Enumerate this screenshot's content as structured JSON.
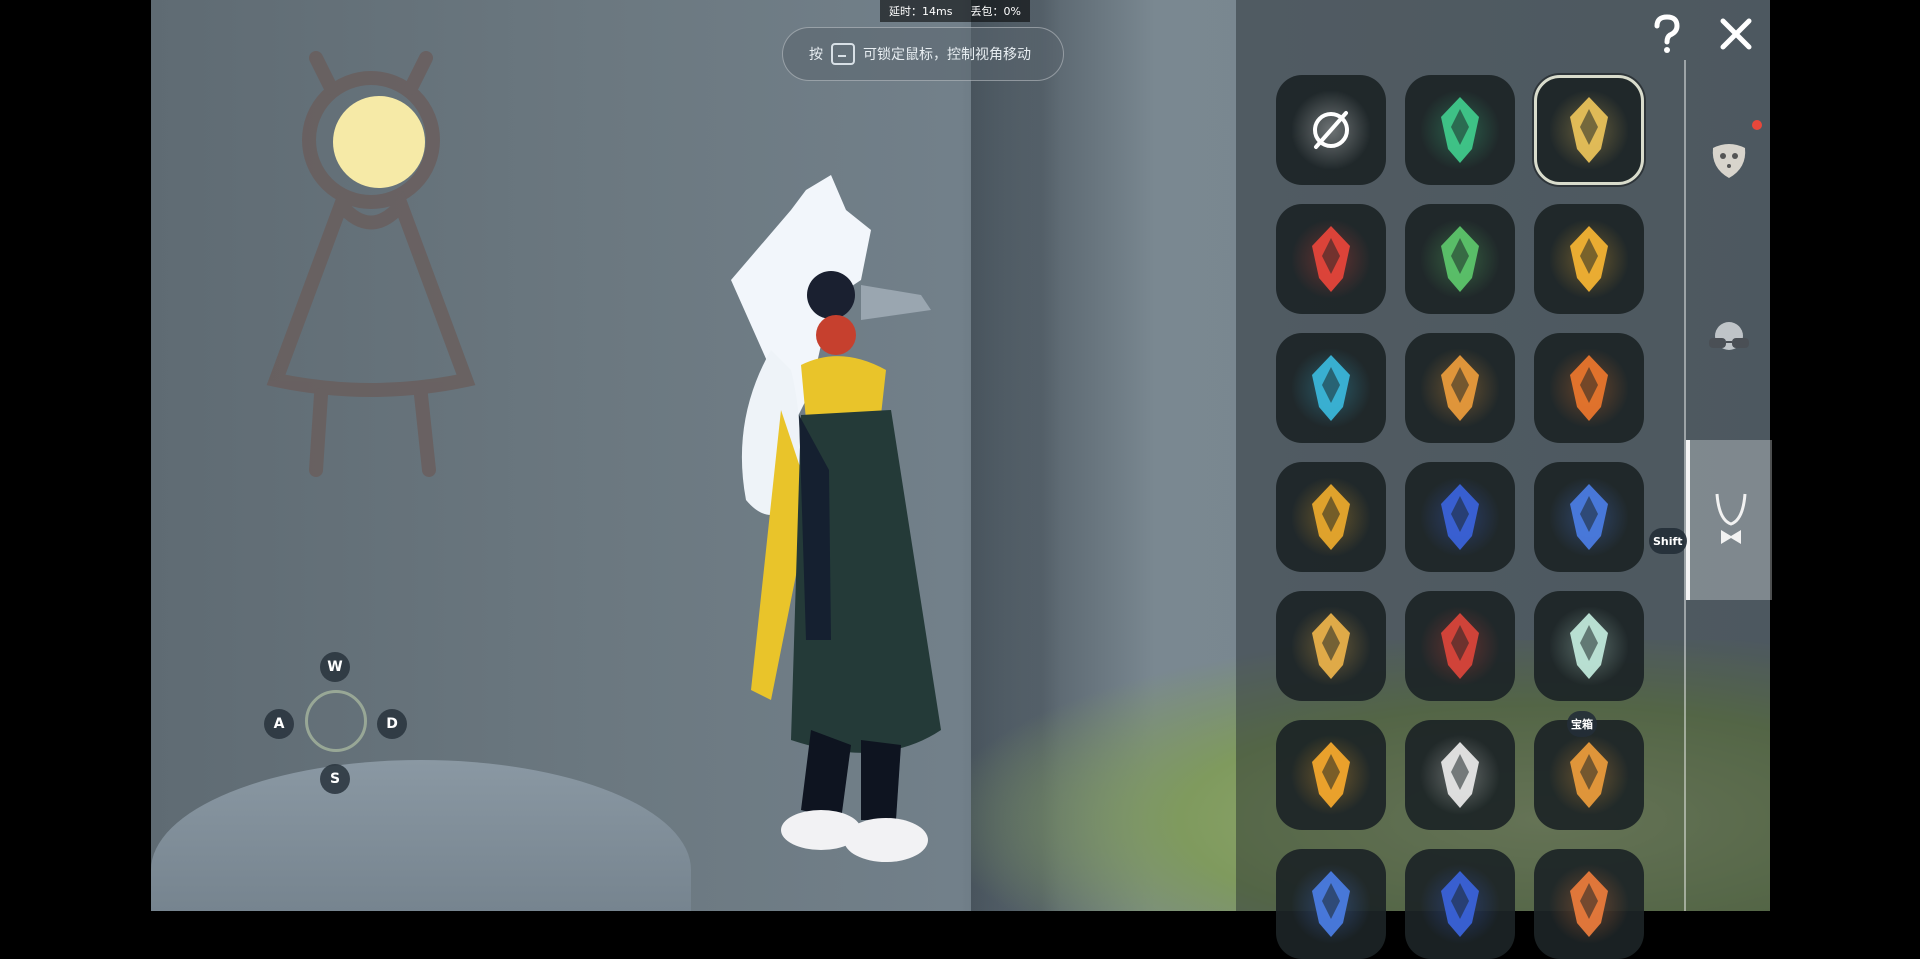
{
  "hud": {
    "latency": "延时：14ms",
    "packet_loss": "丢包：0%"
  },
  "hint": {
    "prefix": "按",
    "text": "可锁定鼠标，控制视角移动"
  },
  "joystick": {
    "up": "W",
    "left": "A",
    "right": "D",
    "down": "S"
  },
  "top_bar": {
    "help_icon": "question-mark-icon",
    "close_icon": "close-x-icon"
  },
  "panel": {
    "shift_hint": "Shift",
    "treasure_label": "宝箱",
    "items": [
      {
        "icon": "none-slash-icon",
        "color": "#ffffff"
      },
      {
        "icon": "trident-emblem-icon",
        "color": "#3fc88a"
      },
      {
        "icon": "star-compass-emblem-icon",
        "color": "#e8c15a",
        "selected": true
      },
      {
        "icon": "castle-emblem-icon",
        "color": "#e4443a"
      },
      {
        "icon": "fleur-de-lis-emblem-icon",
        "color": "#5cc46a"
      },
      {
        "icon": "fox-emblem-icon",
        "color": "#f2b233"
      },
      {
        "icon": "arrow-emblem-icon",
        "color": "#3ab5d8"
      },
      {
        "icon": "gate-emblem-icon",
        "color": "#e89a3b"
      },
      {
        "icon": "crystal-emblem-icon",
        "color": "#e8752c"
      },
      {
        "icon": "wings-emblem-icon",
        "color": "#e8a82c"
      },
      {
        "icon": "rune-emblem-icon",
        "color": "#3a62d8"
      },
      {
        "icon": "moon-star-emblem-icon",
        "color": "#4a7be0"
      },
      {
        "icon": "mountain-emblem-icon",
        "color": "#e8b04a"
      },
      {
        "icon": "flame-emblem-icon",
        "color": "#d8443a"
      },
      {
        "icon": "deer-emblem-icon",
        "color": "#bfe7d9"
      },
      {
        "icon": "key-emblem-icon",
        "color": "#f2a72c"
      },
      {
        "icon": "mouse-emblem-icon",
        "color": "#e6e6e6"
      },
      {
        "icon": "horn-emblem-icon",
        "color": "#e89a3b"
      },
      {
        "icon": "crescent-emblem-icon",
        "color": "#4a7be0"
      },
      {
        "icon": "swirl-emblem-icon",
        "color": "#3a62d8"
      },
      {
        "icon": "cape-emblem-icon",
        "color": "#e87a3b"
      }
    ],
    "tabs": [
      {
        "icon": "mask-tab-icon",
        "active": false
      },
      {
        "icon": "glasses-tab-icon",
        "active": false
      },
      {
        "icon": "necklace-tab-icon",
        "active": true
      }
    ]
  }
}
